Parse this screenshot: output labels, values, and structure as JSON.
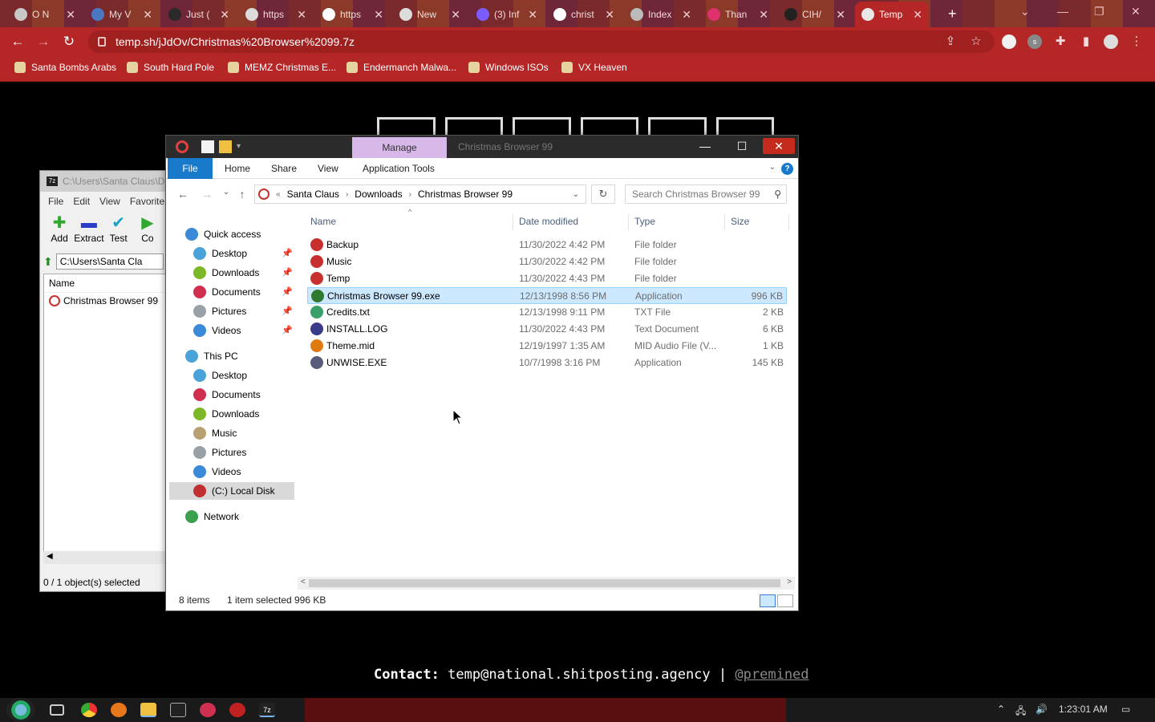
{
  "browser": {
    "tabs": [
      {
        "label": "O N",
        "color": "#c8c8c8"
      },
      {
        "label": "My V",
        "color": "#4a78c0"
      },
      {
        "label": "Just (",
        "color": "#2a2a2a"
      },
      {
        "label": "https",
        "color": "#dcdcdc"
      },
      {
        "label": "https",
        "color": "#ffffff"
      },
      {
        "label": "New",
        "color": "#dcdcdc"
      },
      {
        "label": "(3) Inf",
        "color": "#7b5cff"
      },
      {
        "label": "christ",
        "color": "#ffffff"
      },
      {
        "label": "Index",
        "color": "#bbbbbb"
      },
      {
        "label": "Than",
        "color": "#e0306e"
      },
      {
        "label": "CIH/",
        "color": "#222222"
      },
      {
        "label": "Temp",
        "color": "#e8e8e8"
      }
    ],
    "url": "temp.sh/jJdOv/Christmas%20Browser%2099.7z",
    "bookmarks": [
      {
        "label": "Santa Bombs Arabs"
      },
      {
        "label": "South Hard Pole"
      },
      {
        "label": "MEMZ Christmas E..."
      },
      {
        "label": "Endermanch Malwa..."
      },
      {
        "label": "Windows ISOs"
      },
      {
        "label": "VX Heaven"
      }
    ],
    "accent": "#b52626"
  },
  "page": {
    "contact_label": "Contact:",
    "contact_email": "temp@national.shitposting.agency",
    "contact_sep": "|",
    "contact_handle": "@premined"
  },
  "sevenzip": {
    "title": "C:\\Users\\Santa Claus\\D",
    "menu": [
      "File",
      "Edit",
      "View",
      "Favorite"
    ],
    "tools": [
      {
        "label": "Add",
        "icon": "plus-icon"
      },
      {
        "label": "Extract",
        "icon": "minus-icon"
      },
      {
        "label": "Test",
        "icon": "check-icon"
      },
      {
        "label": "Co",
        "icon": "copy-icon"
      }
    ],
    "path": "C:\\Users\\Santa Cla",
    "column": "Name",
    "item": "Christmas Browser 99",
    "status": "0 / 1 object(s) selected"
  },
  "explorer": {
    "title": "Christmas Browser 99",
    "manage": "Manage",
    "ribbon_tabs": [
      "File",
      "Home",
      "Share",
      "View",
      "Application Tools"
    ],
    "breadcrumb": [
      "Santa Claus",
      "Downloads",
      "Christmas Browser 99"
    ],
    "search_placeholder": "Search Christmas Browser 99",
    "nav": {
      "quick_access": "Quick access",
      "quick_items": [
        "Desktop",
        "Downloads",
        "Documents",
        "Pictures",
        "Videos"
      ],
      "this_pc": "This PC",
      "pc_items": [
        "Desktop",
        "Documents",
        "Downloads",
        "Music",
        "Pictures",
        "Videos",
        "(C:) Local Disk"
      ],
      "network": "Network"
    },
    "columns": {
      "name": "Name",
      "date": "Date modified",
      "type": "Type",
      "size": "Size"
    },
    "files": [
      {
        "name": "Backup",
        "date": "11/30/2022 4:42 PM",
        "type": "File folder",
        "size": "",
        "icon": "#c83030"
      },
      {
        "name": "Music",
        "date": "11/30/2022 4:42 PM",
        "type": "File folder",
        "size": "",
        "icon": "#c83030"
      },
      {
        "name": "Temp",
        "date": "11/30/2022 4:43 PM",
        "type": "File folder",
        "size": "",
        "icon": "#c83030"
      },
      {
        "name": "Christmas Browser 99.exe",
        "date": "12/13/1998 8:56 PM",
        "type": "Application",
        "size": "996 KB",
        "icon": "#2f7a2f"
      },
      {
        "name": "Credits.txt",
        "date": "12/13/1998 9:11 PM",
        "type": "TXT File",
        "size": "2 KB",
        "icon": "#3aa06a"
      },
      {
        "name": "INSTALL.LOG",
        "date": "11/30/2022 4:43 PM",
        "type": "Text Document",
        "size": "6 KB",
        "icon": "#3a3a8a"
      },
      {
        "name": "Theme.mid",
        "date": "12/19/1997 1:35 AM",
        "type": "MID Audio File (V...",
        "size": "1 KB",
        "icon": "#e07a10"
      },
      {
        "name": "UNWISE.EXE",
        "date": "10/7/1998 3:16 PM",
        "type": "Application",
        "size": "145 KB",
        "icon": "#5a5a7a"
      }
    ],
    "selected_index": 3,
    "status_items": "8 items",
    "status_selected": "1 item selected",
    "status_size": "996 KB"
  },
  "taskbar": {
    "clock": "1:23:01 AM"
  }
}
